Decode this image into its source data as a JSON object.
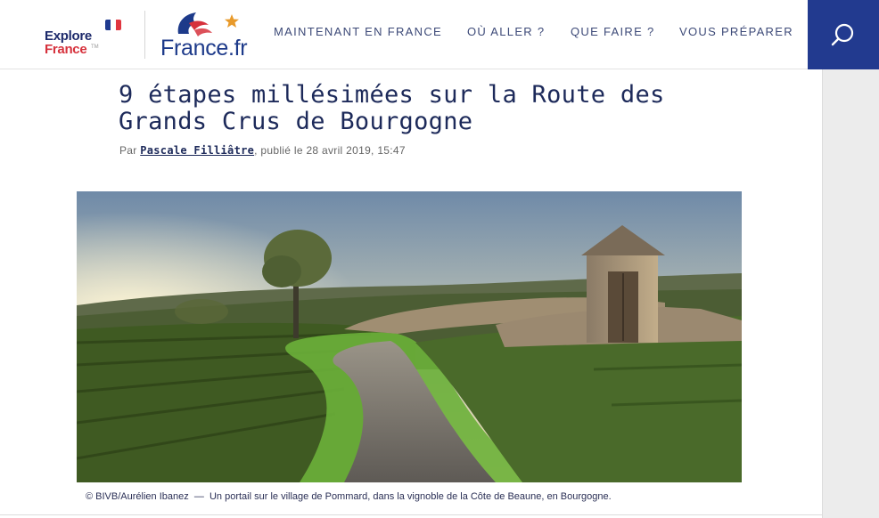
{
  "brand": {
    "explore_line1": "Explore",
    "explore_line2": "France",
    "explore_tm": "TM",
    "site_name": "France.fr",
    "colors": {
      "navy": "#1d2a6b",
      "red": "#d6313c",
      "blue": "#223a8f"
    }
  },
  "nav": {
    "items": [
      {
        "label": "MAINTENANT EN FRANCE"
      },
      {
        "label": "OÙ ALLER ?"
      },
      {
        "label": "QUE FAIRE ?"
      },
      {
        "label": "VOUS PRÉPARER"
      }
    ],
    "search_icon": "search-icon"
  },
  "article": {
    "title": "9 étapes millésimées sur la Route des Grands Crus de Bourgogne",
    "byline_prefix": "Par",
    "author": "Pascale Filliâtre",
    "byline_suffix": ", publié le 28 avril 2019, 15:47"
  },
  "hero": {
    "credit": "© BIVB/Aurélien Ibanez",
    "separator": "—",
    "caption": "Un portail sur le village de Pommard, dans la vignoble de la Côte de Beaune, en Bourgogne."
  }
}
